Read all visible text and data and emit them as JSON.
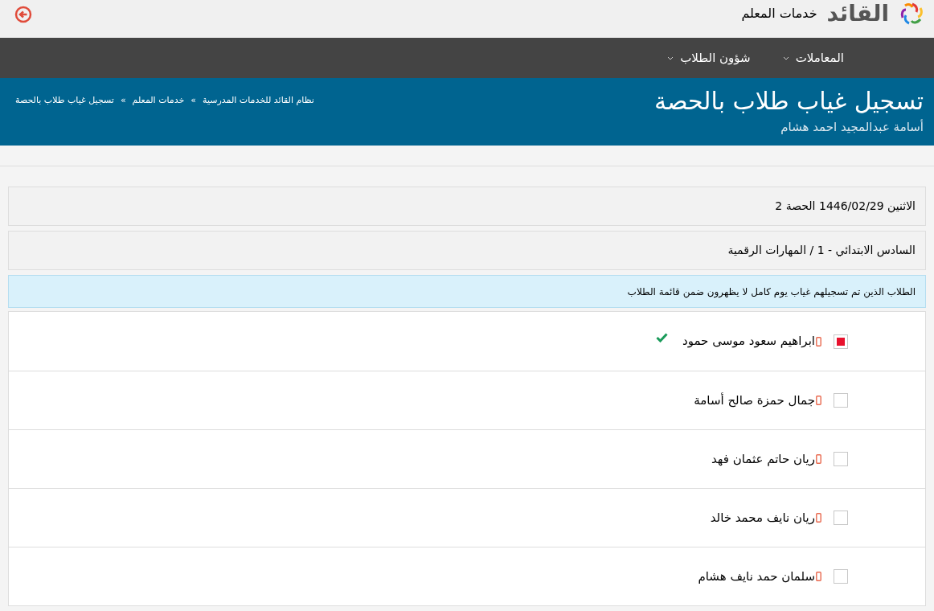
{
  "header": {
    "logo_text": "القائد",
    "section_title": "خدمات المعلم"
  },
  "nav": {
    "items": [
      {
        "label": "المعاملات"
      },
      {
        "label": "شؤون الطلاب"
      }
    ]
  },
  "banner": {
    "title": "تسجيل غياب طلاب بالحصة",
    "subtitle": "أسامة عبدالمجيد احمد هشام",
    "breadcrumb": [
      "نظام القائد للخدمات المدرسية",
      "خدمات المعلم",
      "تسجيل غياب طلاب بالحصة"
    ],
    "separator": "»"
  },
  "session": {
    "date_period": "الاثنين 1446/02/29 الحصة 2",
    "class_subject": "السادس الابتدائي - 1 / المهارات الرقمية"
  },
  "notice": "الطلاب الذين تم تسجيلهم غياب يوم كامل لا يظهرون ضمن قائمة الطلاب",
  "students": [
    {
      "name": "ابراهيم سعود موسى حمود",
      "checked": true,
      "confirmed": true
    },
    {
      "name": "جمال حمزة صالح أسامة",
      "checked": false,
      "confirmed": false
    },
    {
      "name": "ريان حاتم عثمان فهد",
      "checked": false,
      "confirmed": false
    },
    {
      "name": "ريان نايف محمد خالد",
      "checked": false,
      "confirmed": false
    },
    {
      "name": "سلمان حمد نايف هشام",
      "checked": false,
      "confirmed": false
    }
  ]
}
